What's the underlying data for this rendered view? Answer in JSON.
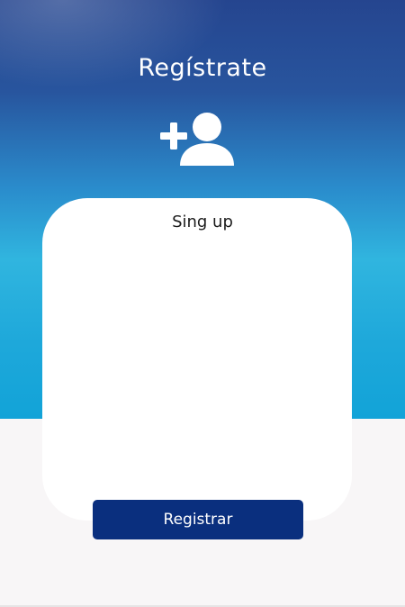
{
  "header": {
    "title": "Regístrate",
    "icon": "add-user-icon"
  },
  "card": {
    "title": "Sing up"
  },
  "actions": {
    "register_label": "Registrar"
  },
  "colors": {
    "gradient_top": "#25458f",
    "gradient_bottom": "#12a3d8",
    "button": "#0a2f7e",
    "background": "#f8f6f7",
    "card": "#ffffff"
  }
}
